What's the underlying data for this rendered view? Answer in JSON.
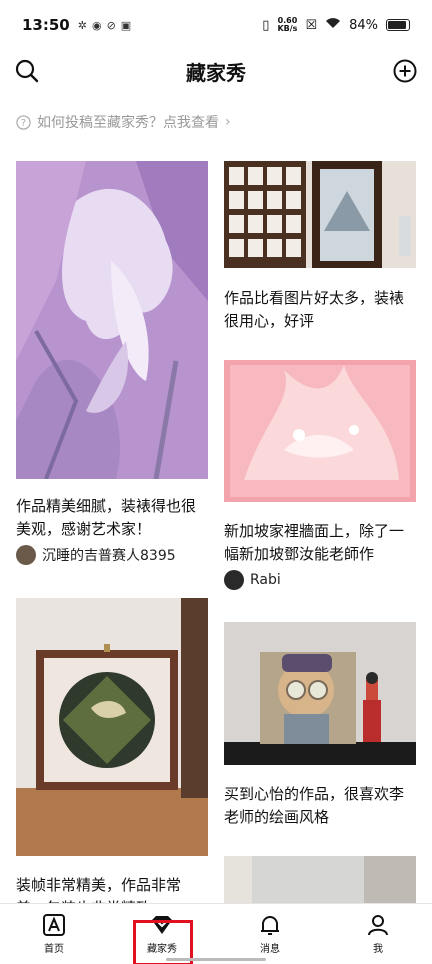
{
  "status": {
    "time": "13:50",
    "speed_top": "0.60",
    "speed_unit": "KB/s",
    "battery": "84%",
    "battery_level": 0.84
  },
  "header": {
    "title": "藏家秀"
  },
  "hint": {
    "text": "如何投稿至藏家秀？点我查看"
  },
  "feed": {
    "left": [
      {
        "title": "作品精美细腻，装裱得也很美观，感谢艺术家！",
        "author": "沉睡的吉普赛人8395"
      },
      {
        "title": "装帧非常精美，作品非常美，包装也非常精致"
      }
    ],
    "right": [
      {
        "title": "作品比看图片好太多，装裱很用心，好评"
      },
      {
        "title": "新加坡家裡牆面上，除了一幅新加坡鄧汝能老師作",
        "author": "Rabi"
      },
      {
        "title": "买到心怡的作品，很喜欢李老师的绘画风格"
      }
    ]
  },
  "tabs": [
    {
      "label": "首页",
      "icon": "home-a-icon"
    },
    {
      "label": "藏家秀",
      "icon": "diamond-icon",
      "active": true
    },
    {
      "label": "消息",
      "icon": "bell-icon"
    },
    {
      "label": "我",
      "icon": "person-icon"
    }
  ]
}
